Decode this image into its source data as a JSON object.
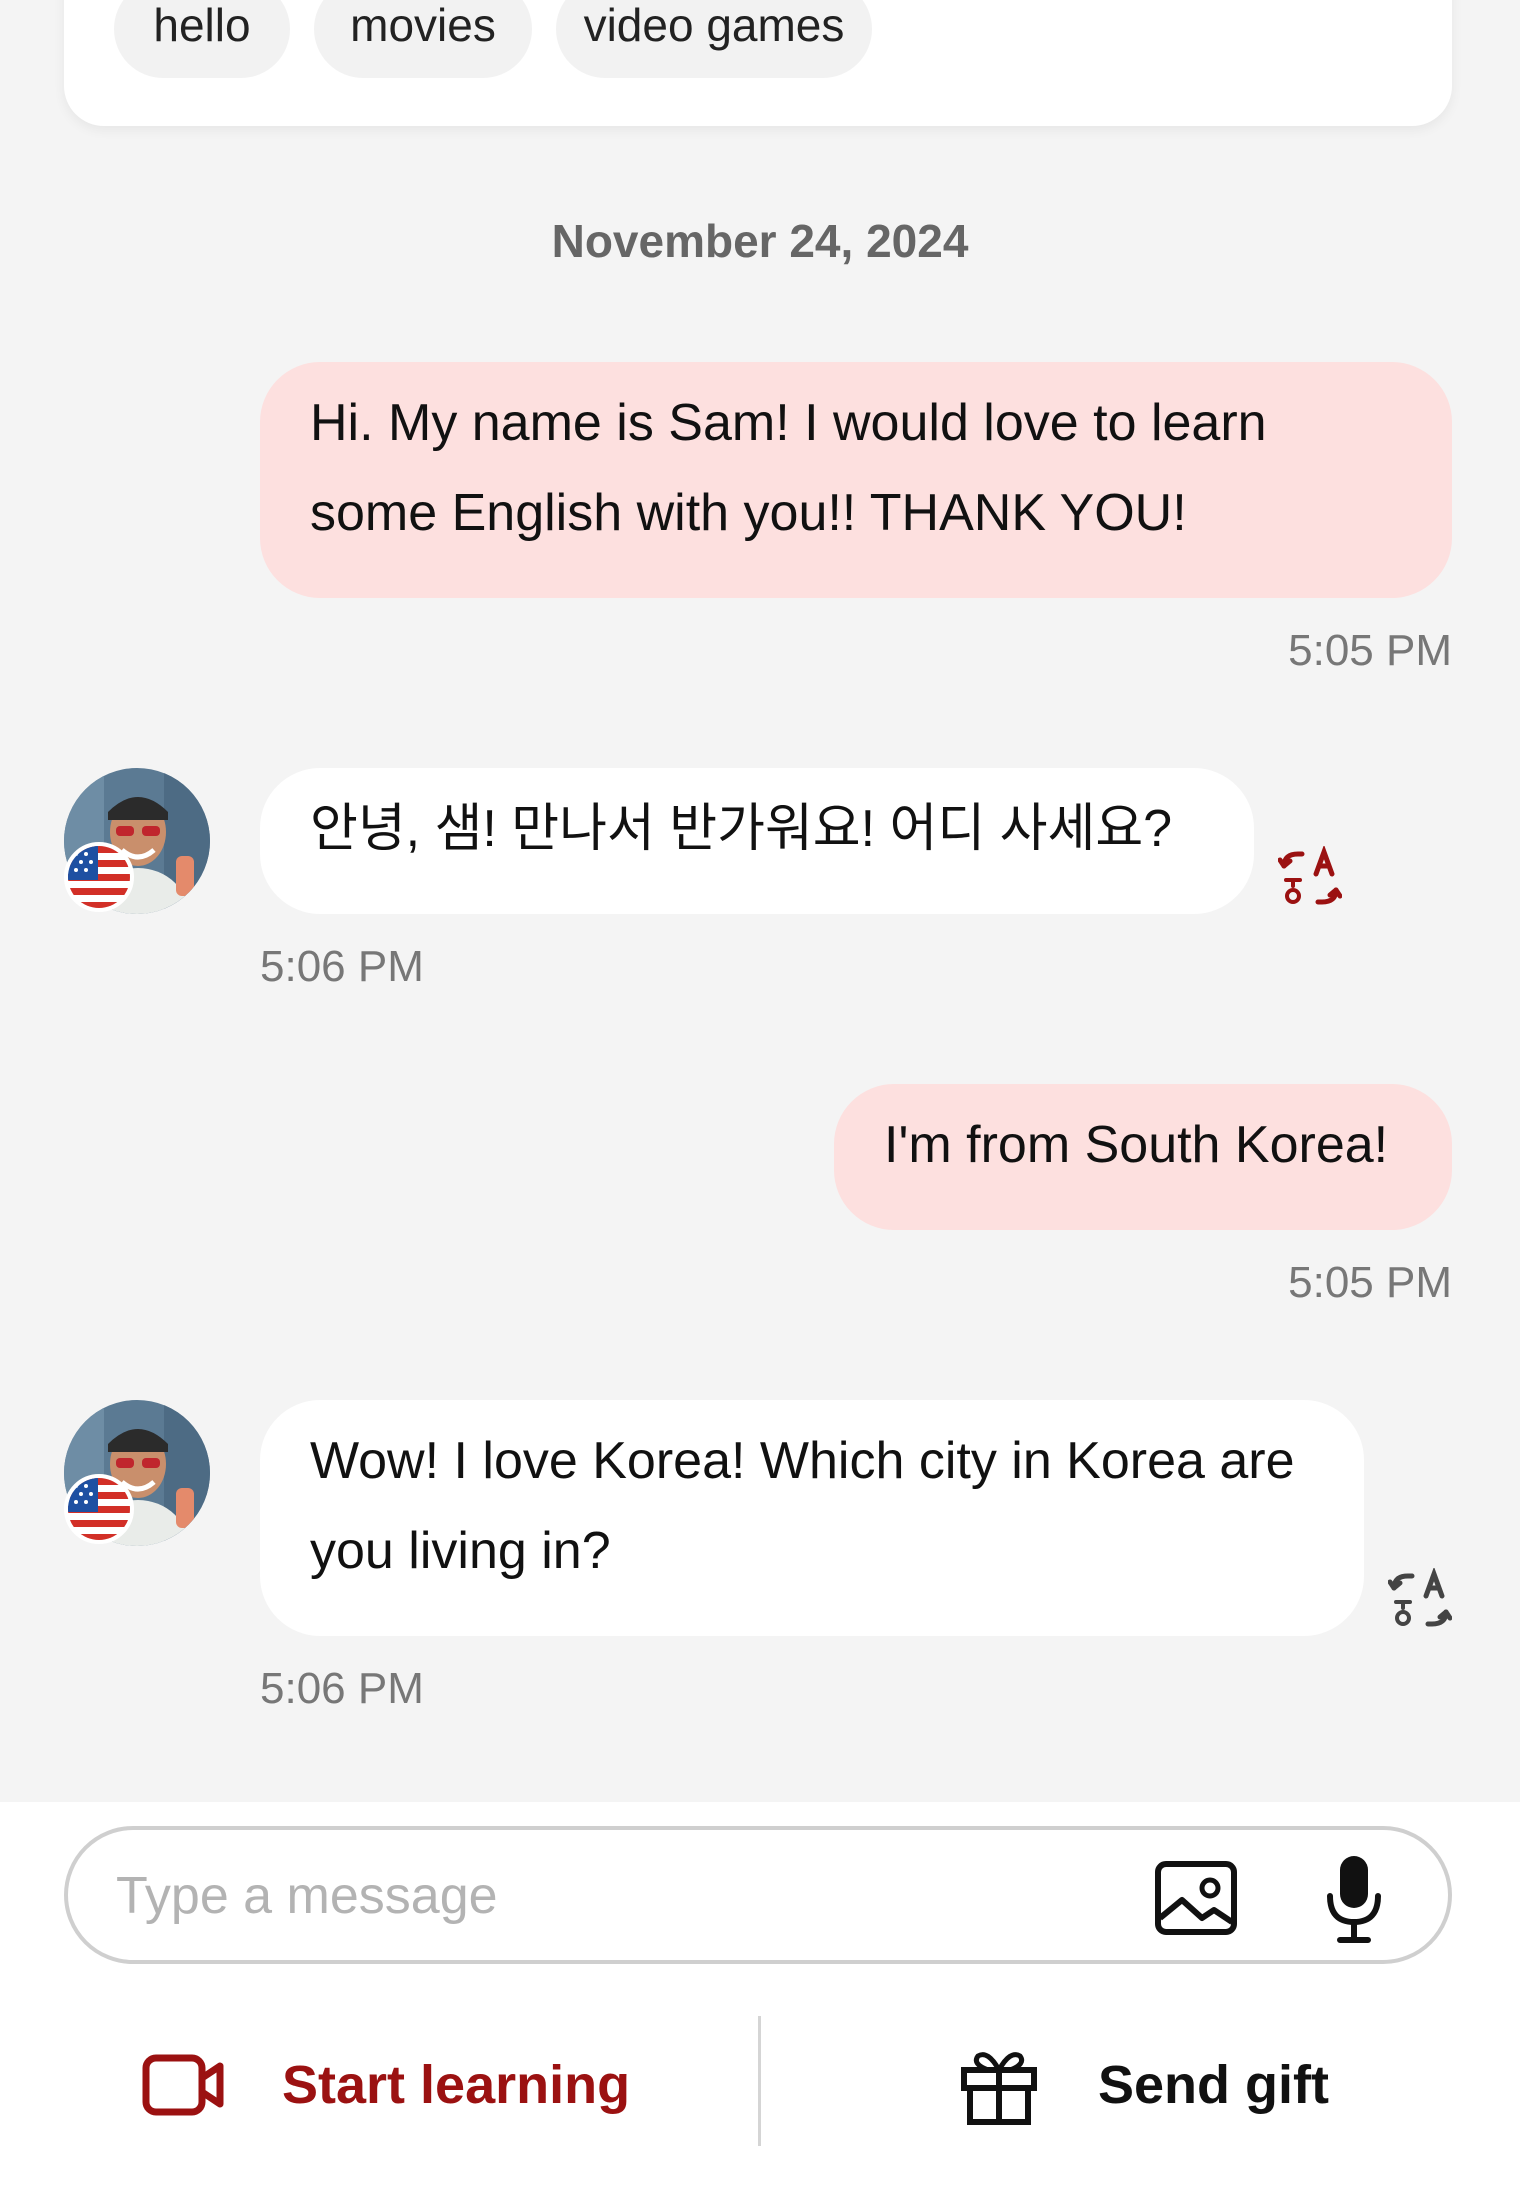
{
  "topics": {
    "chips": [
      "hello",
      "movies",
      "video games"
    ]
  },
  "date_divider": "November 24, 2024",
  "messages": [
    {
      "direction": "out",
      "text_line1": "Hi. My name is Sam! I would love to learn",
      "text_line2": "some English with you!! THANK YOU!",
      "time": "5:05 PM"
    },
    {
      "direction": "in",
      "text": "안녕, 샘! 만나서 반가워요! 어디 사세요?",
      "time": "5:06 PM",
      "avatar_flag": "us-flag-icon"
    },
    {
      "direction": "out",
      "text": "I'm from South Korea!",
      "time": "5:05 PM"
    },
    {
      "direction": "in",
      "text_line1": "Wow! I love Korea! Which city in Korea are",
      "text_line2": "you living in?",
      "time": "5:06 PM",
      "avatar_flag": "us-flag-icon"
    }
  ],
  "composer": {
    "placeholder": "Type a message",
    "image_icon": "image-icon",
    "mic_icon": "microphone-icon"
  },
  "actions": {
    "start_learning": "Start learning",
    "send_gift": "Send gift",
    "start_icon": "video-camera-icon",
    "gift_icon": "gift-icon"
  },
  "colors": {
    "accent": "#9b1111",
    "outgoing_bubble": "#fde0df",
    "incoming_bubble": "#ffffff",
    "chat_background": "#f4f4f4"
  }
}
